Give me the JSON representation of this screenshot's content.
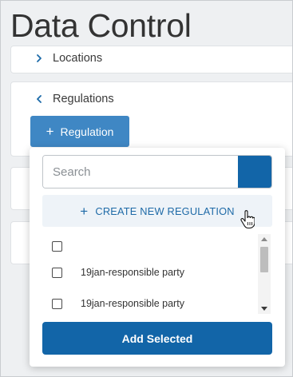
{
  "page": {
    "title": "Data Control"
  },
  "sections": {
    "locations": {
      "label": "Locations"
    },
    "regulations": {
      "label": "Regulations",
      "add_button_label": "Regulation"
    }
  },
  "dropdown": {
    "search": {
      "placeholder": "Search",
      "value": ""
    },
    "create_new_label": "CREATE NEW REGULATION",
    "items": [
      {
        "label": "",
        "checked": false
      },
      {
        "label": "19jan-responsible party",
        "checked": false
      },
      {
        "label": "19jan-responsible party",
        "checked": false
      }
    ],
    "add_selected_label": "Add Selected"
  },
  "colors": {
    "primary": "#1265a8",
    "secondary_button": "#3f87c4",
    "create_new_bg": "#eef3f8",
    "page_bg": "#eef0f2"
  },
  "icons": {
    "locations_chevron": "chevron-right-icon",
    "regulations_chevron": "chevron-left-icon",
    "add": "plus-icon",
    "cursor": "hand-pointer-icon"
  }
}
